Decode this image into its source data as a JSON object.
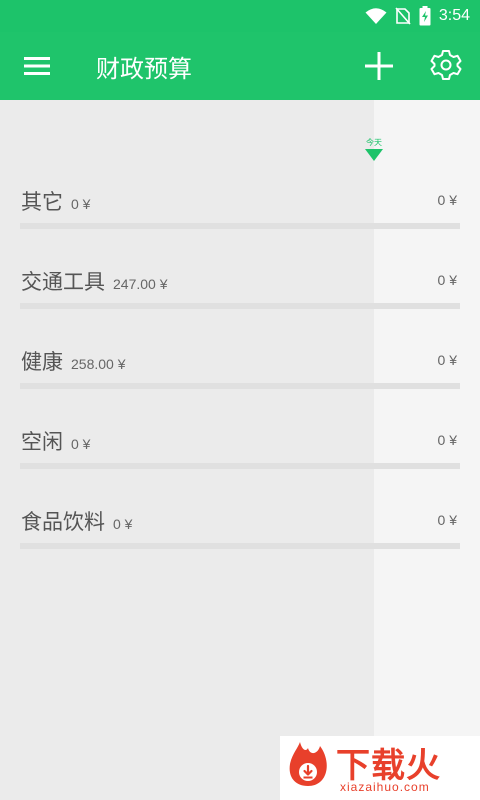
{
  "status_bar": {
    "time": "3:54",
    "icons": [
      "wifi-icon",
      "no-sim-icon",
      "battery-charging-icon"
    ]
  },
  "app_bar": {
    "title": "财政预算",
    "icons": [
      "menu-icon",
      "add-icon",
      "settings-icon"
    ]
  },
  "today_marker": {
    "label": "今天"
  },
  "colors": {
    "accent": "#1dc36a",
    "watermark": "#e8402b"
  },
  "budgets": [
    {
      "name": "其它",
      "spent": "0 ¥",
      "budget": "0 ¥"
    },
    {
      "name": "交通工具",
      "spent": "247.00 ¥",
      "budget": "0 ¥"
    },
    {
      "name": "健康",
      "spent": "258.00 ¥",
      "budget": "0 ¥"
    },
    {
      "name": "空闲",
      "spent": "0 ¥",
      "budget": "0 ¥"
    },
    {
      "name": "食品饮料",
      "spent": "0 ¥",
      "budget": "0 ¥"
    }
  ],
  "watermark": {
    "title": "下载火",
    "url": "xiazaihuo.com"
  }
}
